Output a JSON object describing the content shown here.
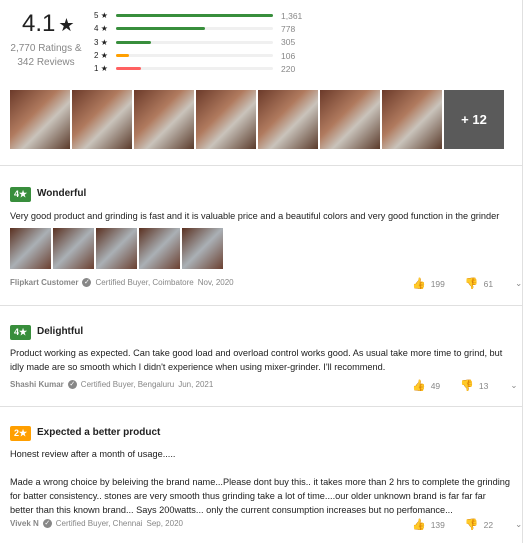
{
  "summary": {
    "average": "4.1",
    "star": "★",
    "ratings_line": "2,770 Ratings &",
    "reviews_line": "342 Reviews",
    "bars": [
      {
        "label": "5",
        "count": "1,361",
        "fraction": 1.0,
        "color": "#388e3c"
      },
      {
        "label": "4",
        "count": "778",
        "fraction": 0.57,
        "color": "#388e3c"
      },
      {
        "label": "3",
        "count": "305",
        "fraction": 0.22,
        "color": "#388e3c"
      },
      {
        "label": "2",
        "count": "106",
        "fraction": 0.08,
        "color": "#ff9f00"
      },
      {
        "label": "1",
        "count": "220",
        "fraction": 0.16,
        "color": "#ff6161"
      }
    ],
    "more_photos": "+ 12"
  },
  "reviews": [
    {
      "rating": "4★",
      "badge_color": "#388e3c",
      "title": "Wonderful",
      "text": "Very good product and grinding is fast and it is valuable price and a beautiful colors and very good function in the grinder",
      "author": "Flipkart Customer",
      "buyer": "Certified Buyer, Coimbatore",
      "date": "Nov, 2020",
      "likes": "199",
      "dislikes": "61"
    },
    {
      "rating": "4★",
      "badge_color": "#388e3c",
      "title": "Delightful",
      "text": "Product working as expected. Can take good load and overload control works good. As usual take more time to grind, but idly made are so smooth which I didn't experience when using mixer-grinder. I'll recommend.",
      "author": "Shashi Kumar",
      "buyer": "Certified Buyer, Bengaluru",
      "date": "Jun, 2021",
      "likes": "49",
      "dislikes": "13"
    },
    {
      "rating": "2★",
      "badge_color": "#ff9f00",
      "title": "Expected a better product",
      "text": "Honest review after a month of usage.....",
      "text2": "Made a wrong choice by beleiving the brand name...Please dont buy this.. it takes more than 2 hrs to complete the grinding for batter consistency.. stones are very smooth thus grinding take a lot of time....our older unknown brand is far far far better than this known brand... Says 200watts... only the current consumption increases but no perfomance...",
      "author": "Vivek N",
      "buyer": "Certified Buyer, Chennai",
      "date": "Sep, 2020",
      "likes": "139",
      "dislikes": "22"
    }
  ]
}
